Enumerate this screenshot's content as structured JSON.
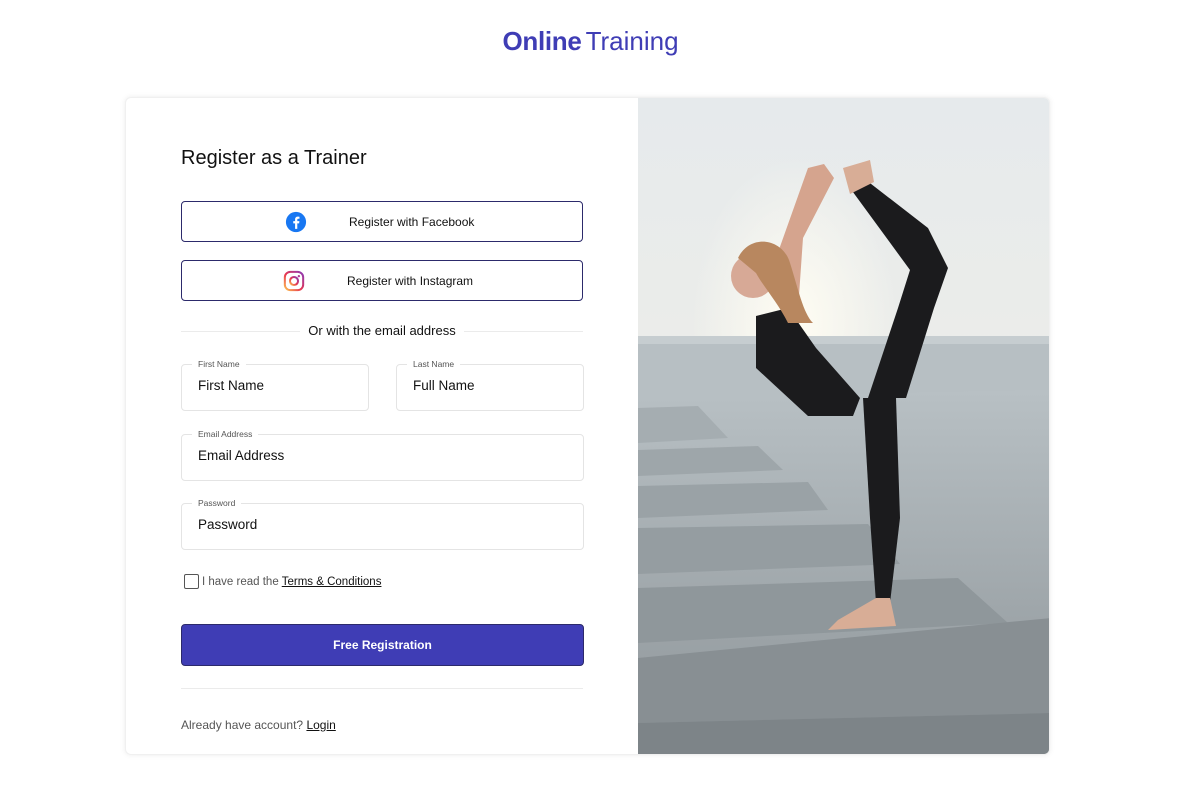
{
  "brand": {
    "bold": "Online",
    "light": "Training",
    "color": "#3f3db5"
  },
  "form": {
    "title": "Register as a Trainer",
    "facebook_label": "Register with Facebook",
    "instagram_label": "Register with Instagram",
    "divider_text": "Or with the email address",
    "fields": {
      "first_name": {
        "label": "First Name",
        "placeholder": "First Name"
      },
      "last_name": {
        "label": "Last Name",
        "placeholder": "Full Name"
      },
      "email": {
        "label": "Email Address",
        "placeholder": "Email Address"
      },
      "password": {
        "label": "Password",
        "placeholder": "Password"
      }
    },
    "terms_prefix": "I have read the",
    "terms_link": "Terms & Conditions",
    "terms_checked": false,
    "submit_label": "Free Registration",
    "login_prefix": "Already have account?",
    "login_link": "Login"
  },
  "icons": {
    "facebook": "facebook-icon",
    "instagram": "instagram-icon"
  },
  "colors": {
    "primary": "#3f3db5",
    "button_border": "#2c2a6b",
    "facebook": "#1877f2"
  },
  "image": {
    "subject": "woman in yoga dancer pose on concrete steps"
  }
}
